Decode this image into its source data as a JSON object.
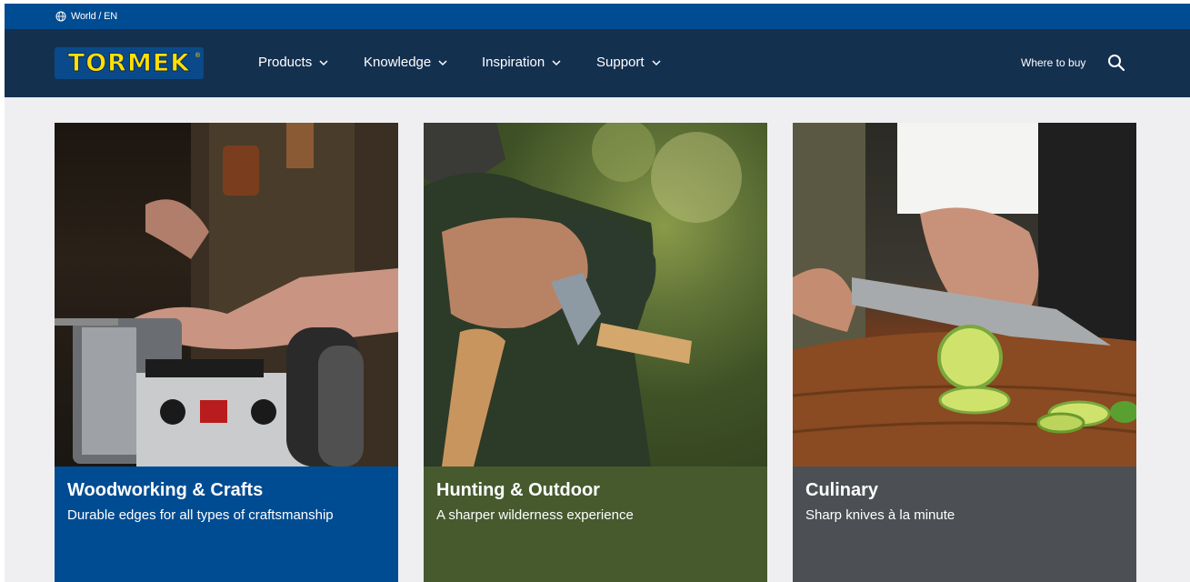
{
  "topbar": {
    "globe_icon": "globe-icon",
    "locale": "World / EN"
  },
  "header": {
    "logo_text": "TORMEK",
    "logo_reg": "®",
    "nav": [
      {
        "label": "Products"
      },
      {
        "label": "Knowledge"
      },
      {
        "label": "Inspiration"
      },
      {
        "label": "Support"
      }
    ],
    "where_to_buy": "Where to buy",
    "search_icon": "search-icon"
  },
  "cards": [
    {
      "title": "Woodworking & Crafts",
      "subtitle": "Durable edges for all types of craftsmanship",
      "color": "#004c92"
    },
    {
      "title": "Hunting & Outdoor",
      "subtitle": "A sharper wilderness experience",
      "color": "#465a2e"
    },
    {
      "title": "Culinary",
      "subtitle": "Sharp knives à la minute",
      "color": "#4c5054"
    }
  ],
  "colors": {
    "topbar": "#004c92",
    "navbar": "#14304f",
    "page_bg": "#efeff1",
    "logo_yellow": "#ffe000"
  }
}
